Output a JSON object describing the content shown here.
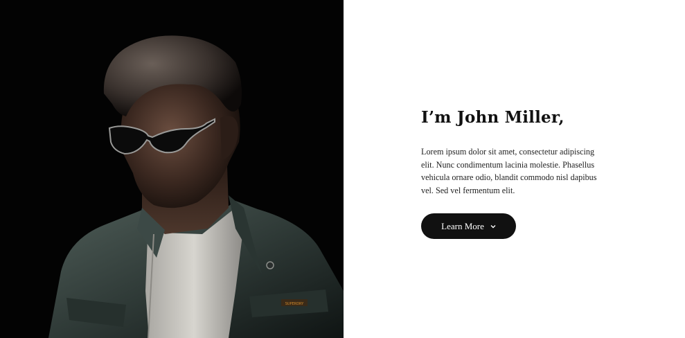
{
  "hero": {
    "heading": "I’m John Miller,",
    "paragraph": "Lorem ipsum dolor sit amet, consectetur adipiscing elit. Nunc condimentum lacinia molestie. Phasellus vehicula ornare odio, blandit commodo nisl dapibus vel. Sed vel fermentum elit.",
    "cta_label": "Learn More",
    "cta_icon": "chevron-down-icon"
  },
  "portrait": {
    "icon": "portrait-photo",
    "jacket_tag": "SUPERDRY"
  },
  "colors": {
    "background": "#ffffff",
    "photo_background": "#030303",
    "button": "#111111",
    "button_text": "#ffffff",
    "heading": "#111111"
  }
}
